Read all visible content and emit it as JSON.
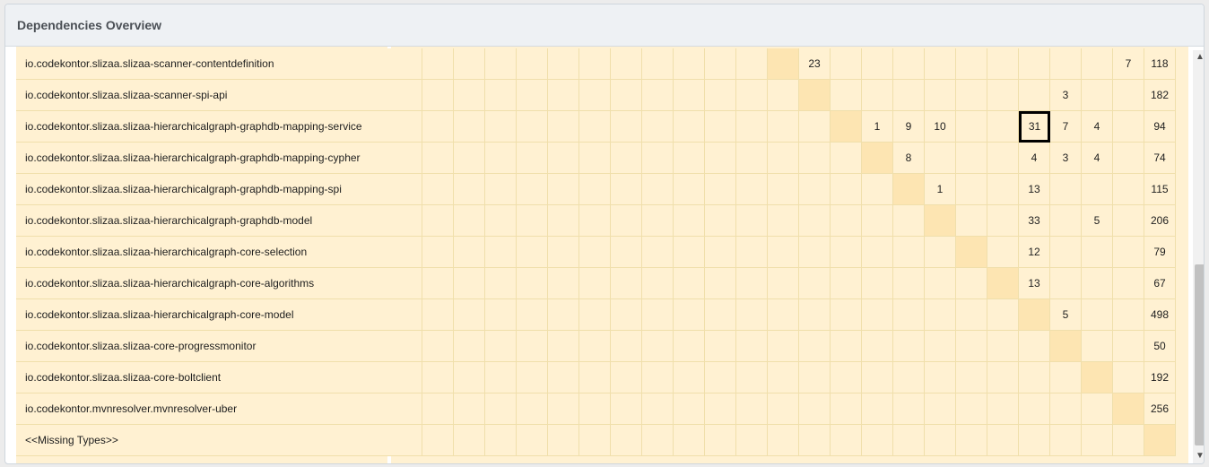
{
  "header": {
    "title": "Dependencies Overview"
  },
  "matrix": {
    "rows": [
      {
        "label": "io.codekontor.slizaa.slizaa-scanner-contentdefinition",
        "values": {
          "13": "23",
          "23": "7",
          "24": "118"
        },
        "diag": 12
      },
      {
        "label": "io.codekontor.slizaa.slizaa-scanner-spi-api",
        "values": {
          "21": "3",
          "24": "182"
        },
        "diag": 13
      },
      {
        "label": "io.codekontor.slizaa.slizaa-hierarchicalgraph-graphdb-mapping-service",
        "values": {
          "15": "1",
          "16": "9",
          "17": "10",
          "20": "31",
          "21": "7",
          "22": "4",
          "24": "94"
        },
        "diag": 14,
        "selected": 20
      },
      {
        "label": "io.codekontor.slizaa.slizaa-hierarchicalgraph-graphdb-mapping-cypher",
        "values": {
          "16": "8",
          "20": "4",
          "21": "3",
          "22": "4",
          "24": "74"
        },
        "diag": 15
      },
      {
        "label": "io.codekontor.slizaa.slizaa-hierarchicalgraph-graphdb-mapping-spi",
        "values": {
          "17": "1",
          "20": "13",
          "24": "115"
        },
        "diag": 16
      },
      {
        "label": "io.codekontor.slizaa.slizaa-hierarchicalgraph-graphdb-model",
        "values": {
          "20": "33",
          "22": "5",
          "24": "206"
        },
        "diag": 17
      },
      {
        "label": "io.codekontor.slizaa.slizaa-hierarchicalgraph-core-selection",
        "values": {
          "20": "12",
          "24": "79"
        },
        "diag": 18
      },
      {
        "label": "io.codekontor.slizaa.slizaa-hierarchicalgraph-core-algorithms",
        "values": {
          "20": "13",
          "24": "67"
        },
        "diag": 19
      },
      {
        "label": "io.codekontor.slizaa.slizaa-hierarchicalgraph-core-model",
        "values": {
          "21": "5",
          "24": "498"
        },
        "diag": 20
      },
      {
        "label": "io.codekontor.slizaa.slizaa-core-progressmonitor",
        "values": {
          "24": "50"
        },
        "diag": 21
      },
      {
        "label": "io.codekontor.slizaa.slizaa-core-boltclient",
        "values": {
          "24": "192"
        },
        "diag": 22
      },
      {
        "label": "io.codekontor.mvnresolver.mvnresolver-uber",
        "values": {
          "24": "256"
        },
        "diag": 23
      },
      {
        "label": "<<Missing Types>>",
        "values": {},
        "diag": 24
      }
    ]
  },
  "scrollbar": {
    "up_icon": "chevron-up-icon",
    "down_icon": "chevron-down-icon"
  }
}
